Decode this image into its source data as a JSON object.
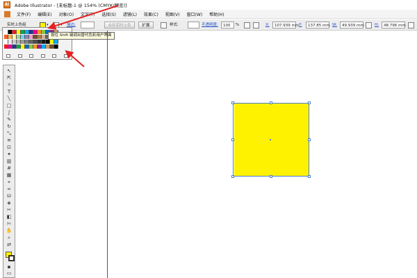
{
  "window": {
    "title": "Adobe Illustrator - [未标题-1 @ 154% (CMYK/预览)]",
    "app_icon": "Ai"
  },
  "menu": [
    "文件(F)",
    "编辑(E)",
    "对象(O)",
    "文字(T)",
    "选择(S)",
    "滤镜(L)",
    "效果(C)",
    "视图(V)",
    "窗口(W)",
    "帮助(H)"
  ],
  "control": {
    "selection_label": "实时上色组",
    "stroke_label": "描边:",
    "merge_button": "合并实时上色",
    "expand_button": "扩展",
    "style_label": "样式:",
    "opacity_label": "不透明度:",
    "opacity_value": "100",
    "opacity_unit": "%",
    "x_label": "X:",
    "x_value": "107.939 mm",
    "y_label": "Y:",
    "y_value": "137.85 mm",
    "w_label": "W:",
    "w_value": "49.939 mm",
    "h_label": "H:",
    "h_value": "48.796 mm"
  },
  "tooltip": "按住 Shift 键调出替代色彩用户界面",
  "swatch_colors": {
    "row1": [
      "#ffffff",
      "#000000",
      "#ed1c24",
      "#fff200",
      "#00a651",
      "#00aeef",
      "#2e3192",
      "#ec008c",
      "#f7941d",
      "#8dc63f",
      "#0072bc",
      "#92278f",
      "#c69c6d"
    ],
    "row2": [
      "#f26522",
      "#fbaf5d",
      "#fff799",
      "#a3d39c",
      "#6dcff6",
      "#8781bd",
      "#f49ac1",
      "#754c24",
      "#a67c52",
      "#c7b299",
      "#736357",
      "#534741",
      "#362f2d"
    ],
    "row3": [
      "#ffffff",
      "#eaeaea",
      "#cccccc",
      "#b3b3b3",
      "#999999",
      "#808080",
      "#666666",
      "#4d4d4d",
      "#333333",
      "#1a1a1a",
      "#000000",
      "#fff200",
      "#00aeef"
    ],
    "row4": [
      "#ed1c24",
      "#ec008c",
      "#2e3192",
      "#00a651",
      "#fff200",
      "#0072bc",
      "#8dc63f",
      "#f7941d",
      "#92278f",
      "#00aeef",
      "#c69c6d",
      "#754c24",
      "#000000"
    ]
  },
  "artwork": {
    "fill_color": "#fff200",
    "selection_color": "#4b7fd1"
  }
}
